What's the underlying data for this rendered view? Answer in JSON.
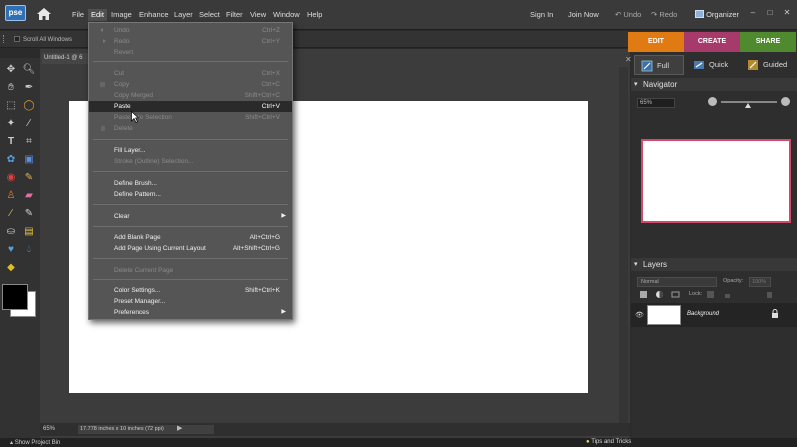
{
  "app": {
    "logo_text": "pse"
  },
  "menubar": {
    "items": [
      "File",
      "Edit",
      "Image",
      "Enhance",
      "Layer",
      "Select",
      "Filter",
      "View",
      "Window",
      "Help"
    ],
    "sign_in": "Sign In",
    "join_now": "Join Now",
    "undo": "Undo",
    "redo": "Redo",
    "organizer": "Organizer"
  },
  "options_bar": {
    "scroll_all_windows": "Scroll All Windows"
  },
  "document": {
    "tab_title": "Untitled-1 @ 6",
    "zoom": "65%",
    "info": "17.778 inches x 10 inches (72 ppi)"
  },
  "edit_menu": {
    "undo": {
      "label": "Undo",
      "shortcut": "Ctrl+Z"
    },
    "redo": {
      "label": "Redo",
      "shortcut": "Ctrl+Y"
    },
    "revert": {
      "label": "Revert"
    },
    "cut": {
      "label": "Cut",
      "shortcut": "Ctrl+X"
    },
    "copy": {
      "label": "Copy",
      "shortcut": "Ctrl+C"
    },
    "copy_merged": {
      "label": "Copy Merged",
      "shortcut": "Shift+Ctrl+C"
    },
    "paste": {
      "label": "Paste",
      "shortcut": "Ctrl+V"
    },
    "paste_into": {
      "label": "Paste Into Selection",
      "shortcut": "Shift+Ctrl+V"
    },
    "delete": {
      "label": "Delete"
    },
    "fill_layer": {
      "label": "Fill Layer..."
    },
    "stroke": {
      "label": "Stroke (Outline) Selection..."
    },
    "define_brush": {
      "label": "Define Brush..."
    },
    "define_pattern": {
      "label": "Define Pattern..."
    },
    "clear": {
      "label": "Clear"
    },
    "add_blank_page": {
      "label": "Add Blank Page",
      "shortcut": "Alt+Ctrl+G"
    },
    "add_page_layout": {
      "label": "Add Page Using Current Layout",
      "shortcut": "Alt+Shift+Ctrl+G"
    },
    "delete_page": {
      "label": "Delete Current Page"
    },
    "color_settings": {
      "label": "Color Settings...",
      "shortcut": "Shift+Ctrl+K"
    },
    "preset_manager": {
      "label": "Preset Manager..."
    },
    "preferences": {
      "label": "Preferences"
    }
  },
  "modes": {
    "edit": "EDIT",
    "create": "CREATE",
    "share": "SHARE"
  },
  "edit_modes": {
    "full": "Full",
    "quick": "Quick",
    "guided": "Guided"
  },
  "navigator": {
    "title": "Navigator",
    "zoom": "65%",
    "zoom_level": 0.45
  },
  "layers": {
    "title": "Layers",
    "blend_mode": "Normal",
    "opacity_label": "Opacity:",
    "opacity": "100%",
    "lock_label": "Lock:",
    "layer_name": "Background"
  },
  "bottom": {
    "show_project_bin": "Show Project Bin",
    "tips": "Tips and Tricks"
  },
  "colors": {
    "edit_tab": "#e07a12",
    "create_tab": "#a63a6b",
    "share_tab": "#4f8a2e",
    "foreground": "#000000",
    "background": "#ffffff"
  }
}
